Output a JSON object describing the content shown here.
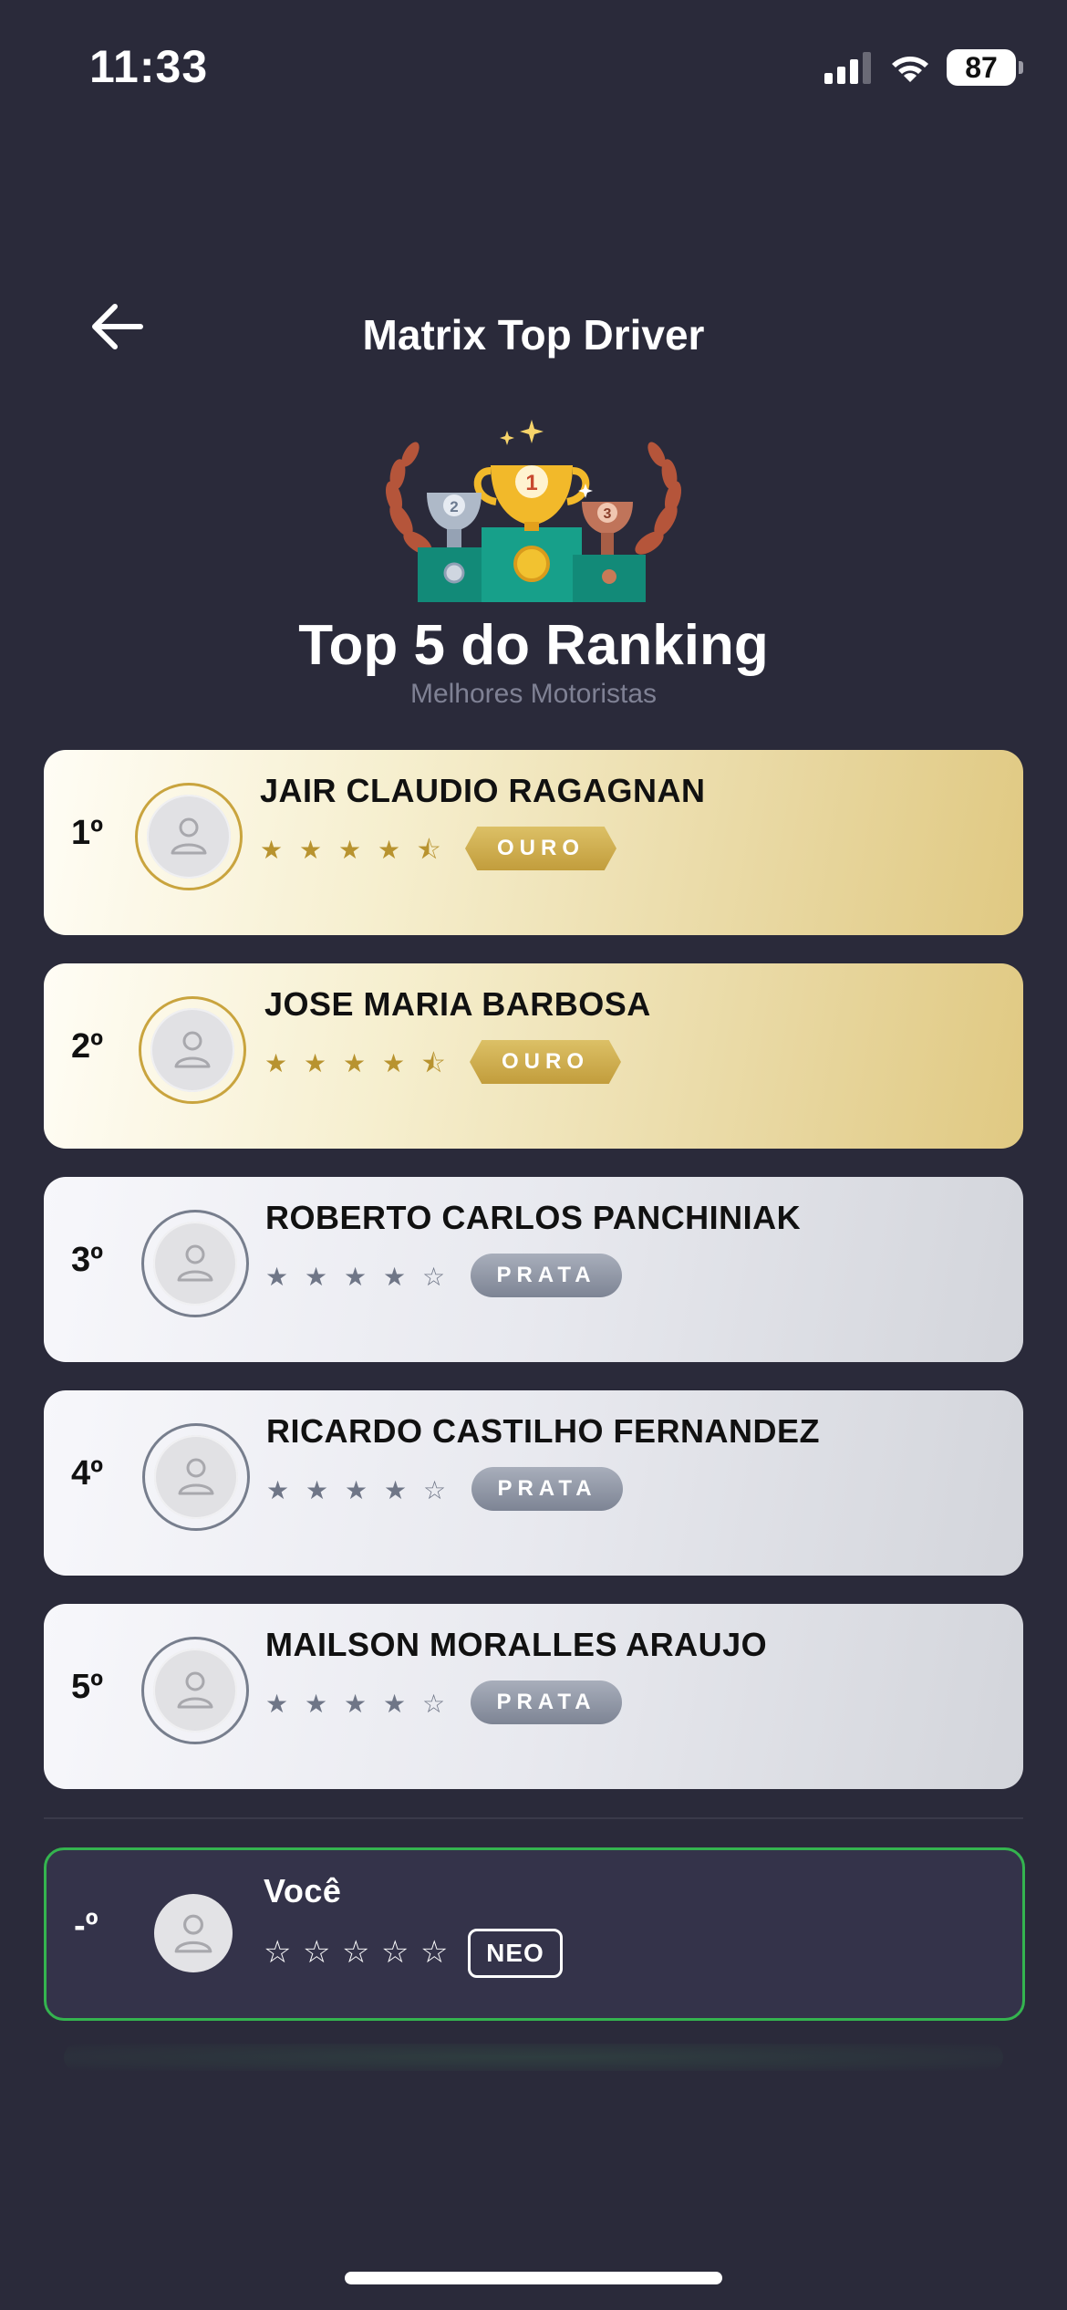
{
  "status_bar": {
    "time": "11:33",
    "battery": "87"
  },
  "header": {
    "title": "Matrix Top Driver"
  },
  "hero": {
    "title": "Top 5 do Ranking",
    "subtitle": "Melhores Motoristas"
  },
  "ranking": [
    {
      "rank": "1º",
      "name": "JAIR CLAUDIO RAGAGNAN",
      "stars": [
        "★",
        "★",
        "★",
        "★",
        "⯪"
      ],
      "badge": "OURO",
      "tier": "gold"
    },
    {
      "rank": "2º",
      "name": "JOSE MARIA BARBOSA",
      "stars": [
        "★",
        "★",
        "★",
        "★",
        "⯪"
      ],
      "badge": "OURO",
      "tier": "gold"
    },
    {
      "rank": "3º",
      "name": "ROBERTO CARLOS PANCHINIAK",
      "stars": [
        "★",
        "★",
        "★",
        "★",
        "☆"
      ],
      "badge": "PRATA",
      "tier": "silver"
    },
    {
      "rank": "4º",
      "name": "RICARDO CASTILHO FERNANDEZ",
      "stars": [
        "★",
        "★",
        "★",
        "★",
        "☆"
      ],
      "badge": "PRATA",
      "tier": "silver"
    },
    {
      "rank": "5º",
      "name": "MAILSON MORALLES ARAUJO",
      "stars": [
        "★",
        "★",
        "★",
        "★",
        "☆"
      ],
      "badge": "PRATA",
      "tier": "silver"
    }
  ],
  "you": {
    "rank": "-º",
    "name": "Você",
    "stars": [
      "☆",
      "☆",
      "☆",
      "☆",
      "☆"
    ],
    "badge": "NEO"
  }
}
